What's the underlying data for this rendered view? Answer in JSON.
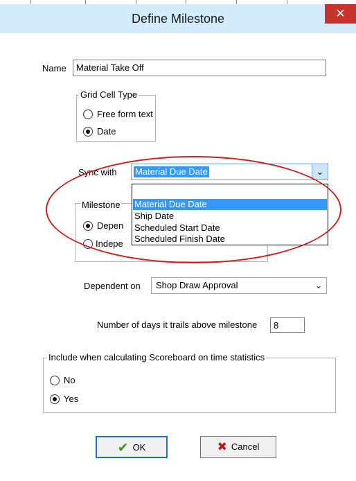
{
  "dialog": {
    "title": "Define Milestone",
    "close_glyph": "✕"
  },
  "name": {
    "label": "Name",
    "value": "Material Take Off"
  },
  "grid_cell_type": {
    "legend": "Grid Cell Type",
    "options": [
      "Free form text",
      "Date"
    ],
    "selected": "Date"
  },
  "sync_with": {
    "label": "Sync with",
    "value": "Material Due Date",
    "options": [
      "Material Due Date",
      "Ship Date",
      "Scheduled Start Date",
      "Scheduled Finish Date"
    ]
  },
  "milestone_group": {
    "legend_visible": "Milestone",
    "option_dependent_visible": "Depen",
    "option_independent_visible": "Indepe"
  },
  "dependent_on": {
    "label": "Dependent on",
    "value": "Shop Draw Approval"
  },
  "trail_days": {
    "label": "Number of days it trails above milestone",
    "value": "8"
  },
  "scoreboard": {
    "legend": "Include when calculating Scoreboard on time statistics",
    "options": [
      "No",
      "Yes"
    ],
    "selected": "Yes"
  },
  "buttons": {
    "ok_label": "OK",
    "cancel_label": "Cancel"
  },
  "icons": {
    "ok": "check-icon",
    "cancel": "x-icon",
    "dropdown": "chevron-down-icon"
  },
  "colors": {
    "titlebar": "#d2ecfb",
    "close_button": "#c7342b",
    "selection": "#3399ff",
    "annotation_ellipse": "#d21d1d",
    "ok_check": "#3a9a1f",
    "cancel_x": "#c01818"
  }
}
